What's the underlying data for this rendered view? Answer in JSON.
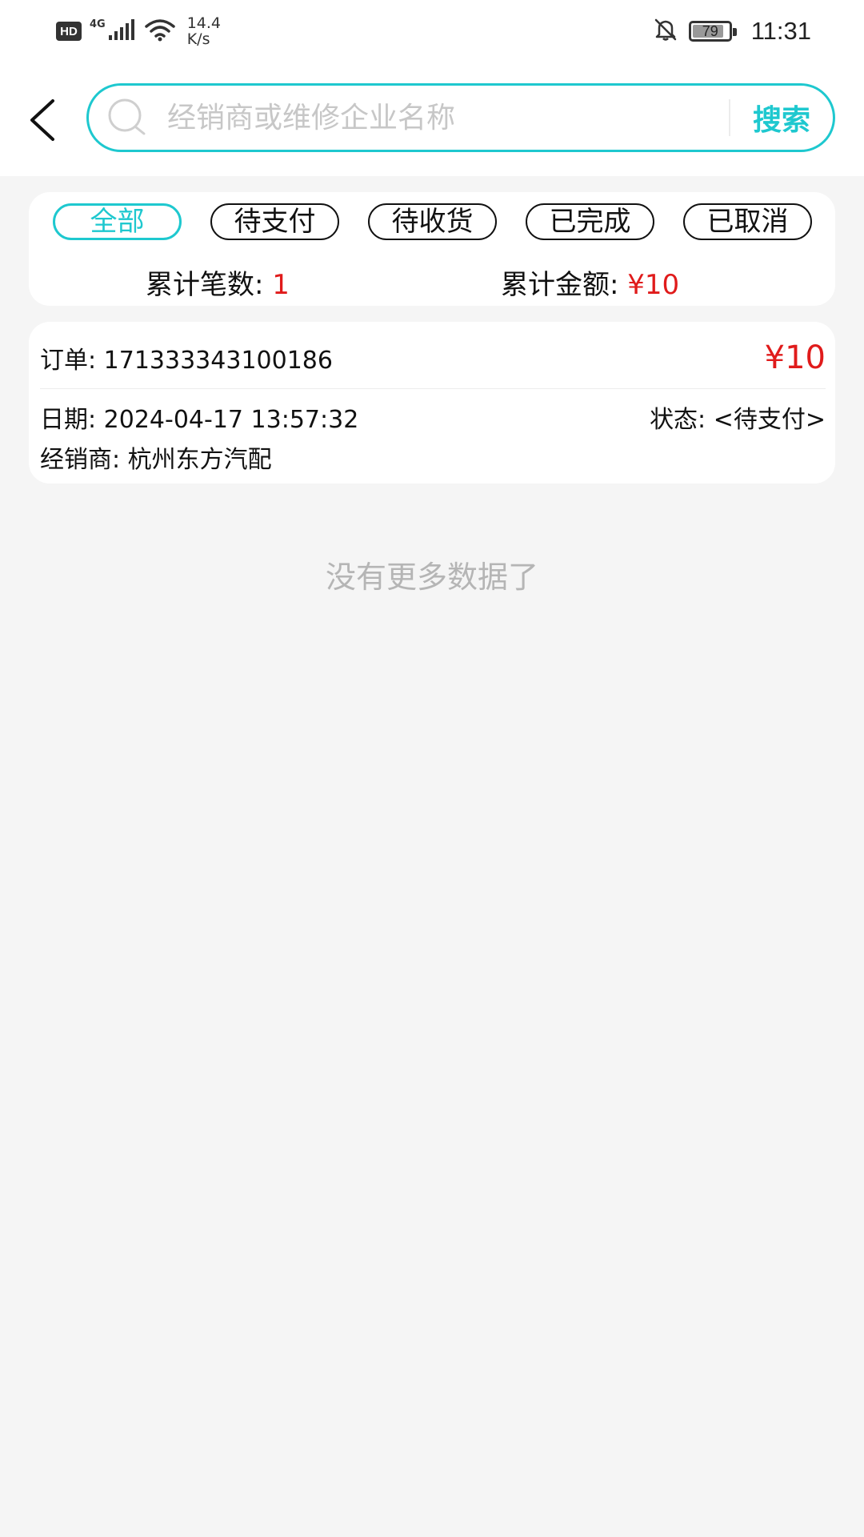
{
  "status_bar": {
    "hd": "HD",
    "network": "4G",
    "speed_value": "14.4",
    "speed_unit": "K/s",
    "battery": "79",
    "battery_level": 0.79,
    "time": "11:31"
  },
  "header": {
    "search_placeholder": "经销商或维修企业名称",
    "search_button": "搜索",
    "accent_color": "#1ec8cf"
  },
  "filter": {
    "tabs": [
      {
        "label": "全部",
        "active": true
      },
      {
        "label": "待支付",
        "active": false
      },
      {
        "label": "待收货",
        "active": false
      },
      {
        "label": "已完成",
        "active": false
      },
      {
        "label": "已取消",
        "active": false
      }
    ],
    "count_label": "累计笔数:",
    "count_value": "1",
    "amount_label": "累计金额:",
    "amount_value": "¥10",
    "highlight_color": "#e01b1b"
  },
  "orders": [
    {
      "order_label": "订单:",
      "order_no": "171333343100186",
      "amount": "¥10",
      "date_label": "日期:",
      "date": "2024-04-17 13:57:32",
      "status_label": "状态:",
      "status": "<待支付>",
      "dealer_label": "经销商:",
      "dealer": "杭州东方汽配"
    }
  ],
  "list_end_text": "没有更多数据了"
}
